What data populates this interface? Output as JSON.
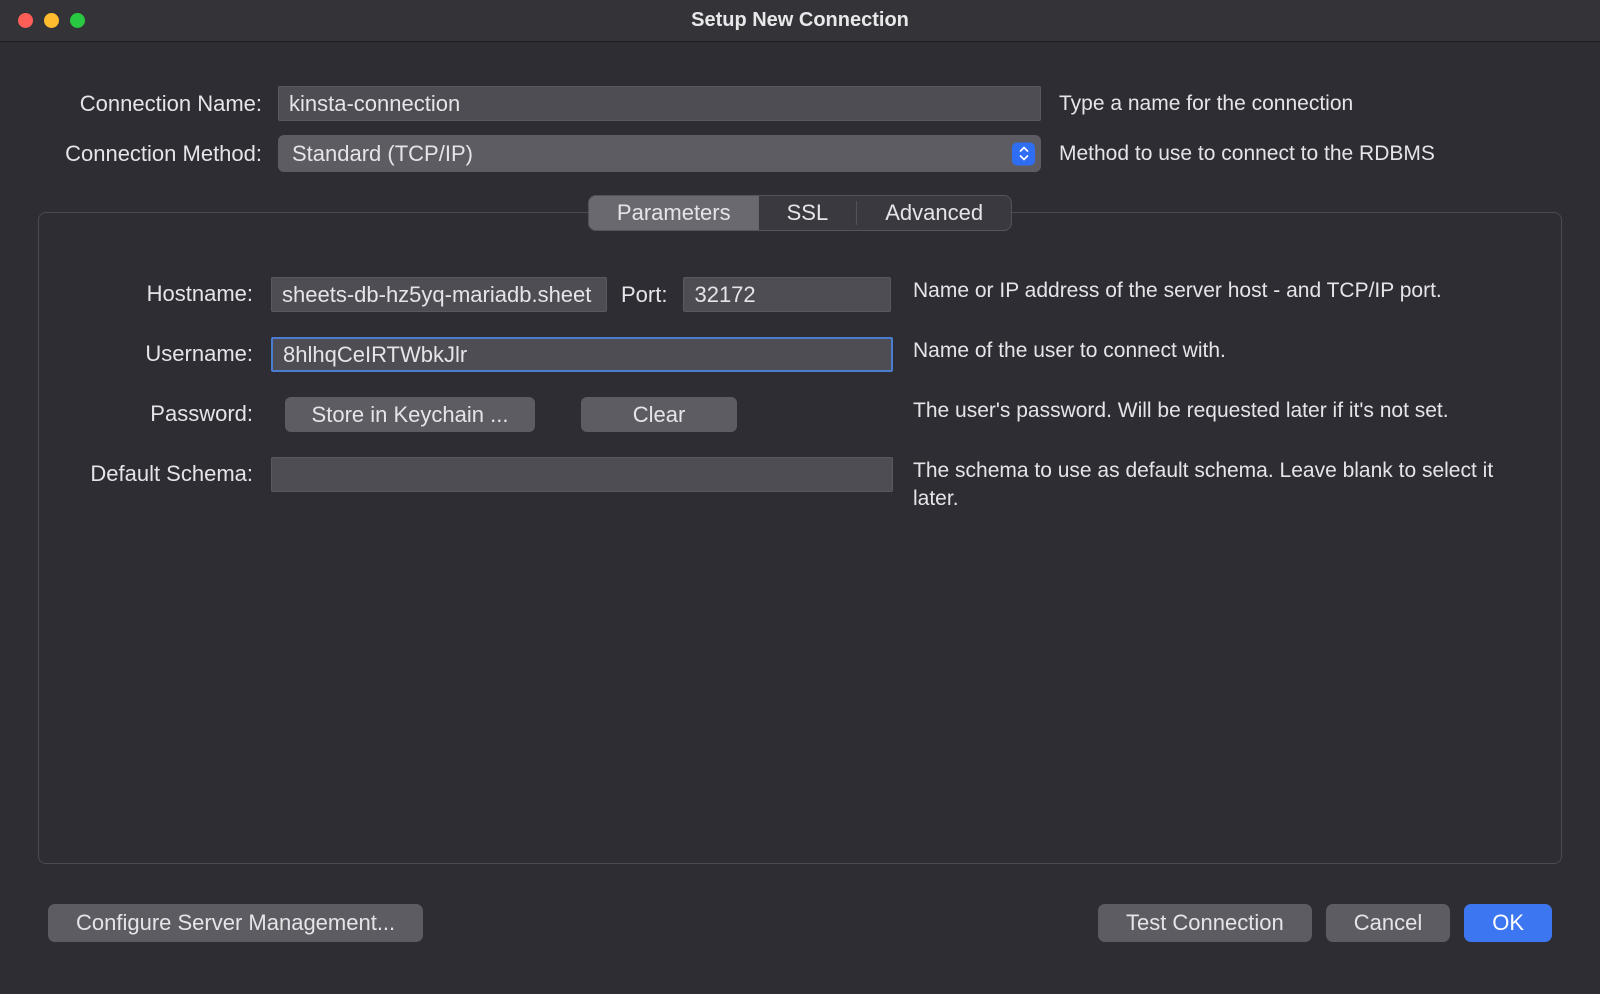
{
  "window": {
    "title": "Setup New Connection"
  },
  "fields": {
    "connection_name": {
      "label": "Connection Name:",
      "value": "kinsta-connection",
      "hint": "Type a name for the connection"
    },
    "connection_method": {
      "label": "Connection Method:",
      "value": "Standard (TCP/IP)",
      "hint": "Method to use to connect to the RDBMS"
    }
  },
  "tabs": {
    "parameters": "Parameters",
    "ssl": "SSL",
    "advanced": "Advanced"
  },
  "params": {
    "hostname": {
      "label": "Hostname:",
      "value": "sheets-db-hz5yq-mariadb.sheet",
      "port_label": "Port:",
      "port_value": "32172",
      "hint": "Name or IP address of the server host - and TCP/IP port."
    },
    "username": {
      "label": "Username:",
      "value": "8hlhqCeIRTWbkJlr",
      "hint": "Name of the user to connect with."
    },
    "password": {
      "label": "Password:",
      "store_button": "Store in Keychain ...",
      "clear_button": "Clear",
      "hint": "The user's password. Will be requested later if it's not set."
    },
    "default_schema": {
      "label": "Default Schema:",
      "value": "",
      "hint": "The schema to use as default schema. Leave blank to select it later."
    }
  },
  "footer": {
    "configure": "Configure Server Management...",
    "test": "Test Connection",
    "cancel": "Cancel",
    "ok": "OK"
  }
}
